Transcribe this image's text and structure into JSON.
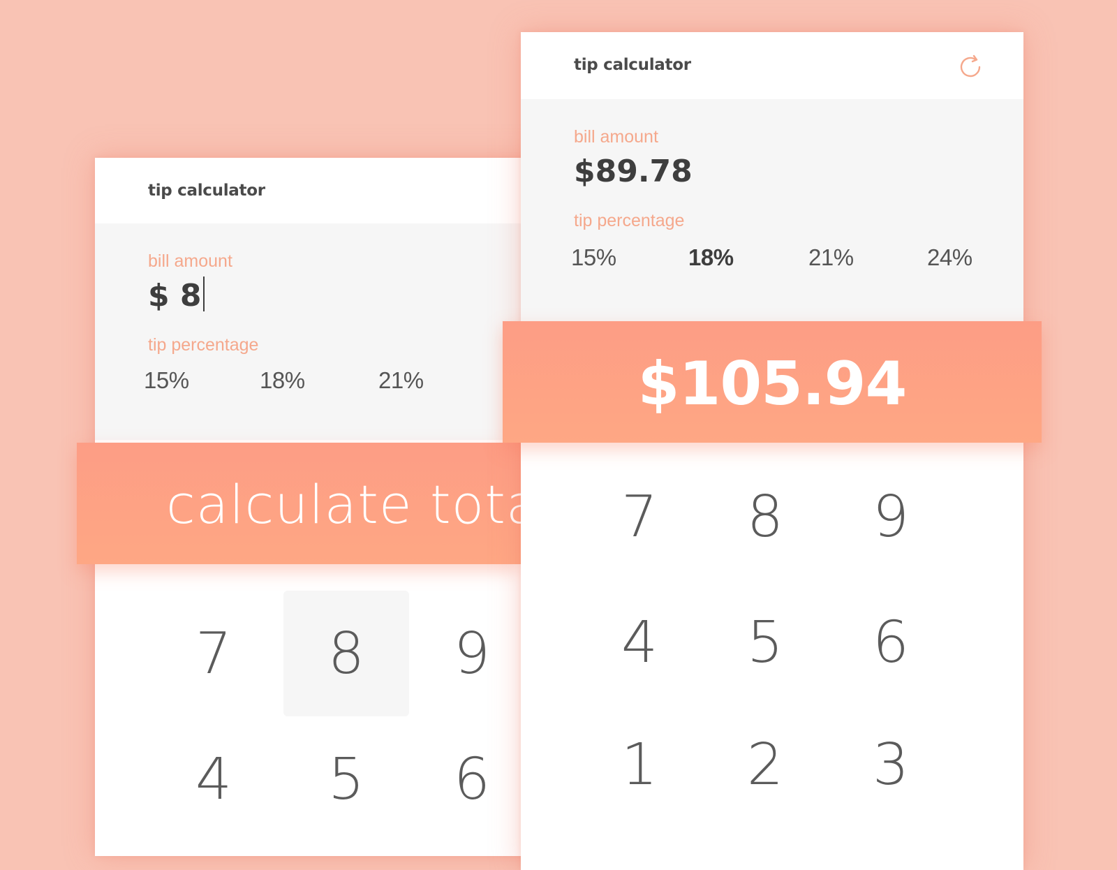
{
  "colors": {
    "background": "#f9c3b4",
    "accent": "#f5a88c",
    "band_gradient_top": "#fd9d85",
    "band_gradient_bottom": "#fea784",
    "text_dark": "#3e3e3e"
  },
  "back_screen": {
    "title": "tip calculator",
    "bill_label": "bill amount",
    "bill_value": "$ 8",
    "tip_label": "tip percentage",
    "tips": [
      "15%",
      "18%",
      "21%"
    ],
    "button_label": "calculate total",
    "keys": [
      "7",
      "8",
      "9",
      "4",
      "5",
      "6"
    ],
    "pressed_key": "8"
  },
  "front_screen": {
    "title": "tip calculator",
    "refresh_icon": "refresh-icon",
    "bill_label": "bill amount",
    "bill_value": "$89.78",
    "tip_label": "tip percentage",
    "tips": [
      "15%",
      "18%",
      "21%",
      "24%"
    ],
    "selected_tip": "18%",
    "total": "$105.94",
    "keys": [
      "7",
      "8",
      "9",
      "4",
      "5",
      "6",
      "1",
      "2",
      "3"
    ]
  }
}
